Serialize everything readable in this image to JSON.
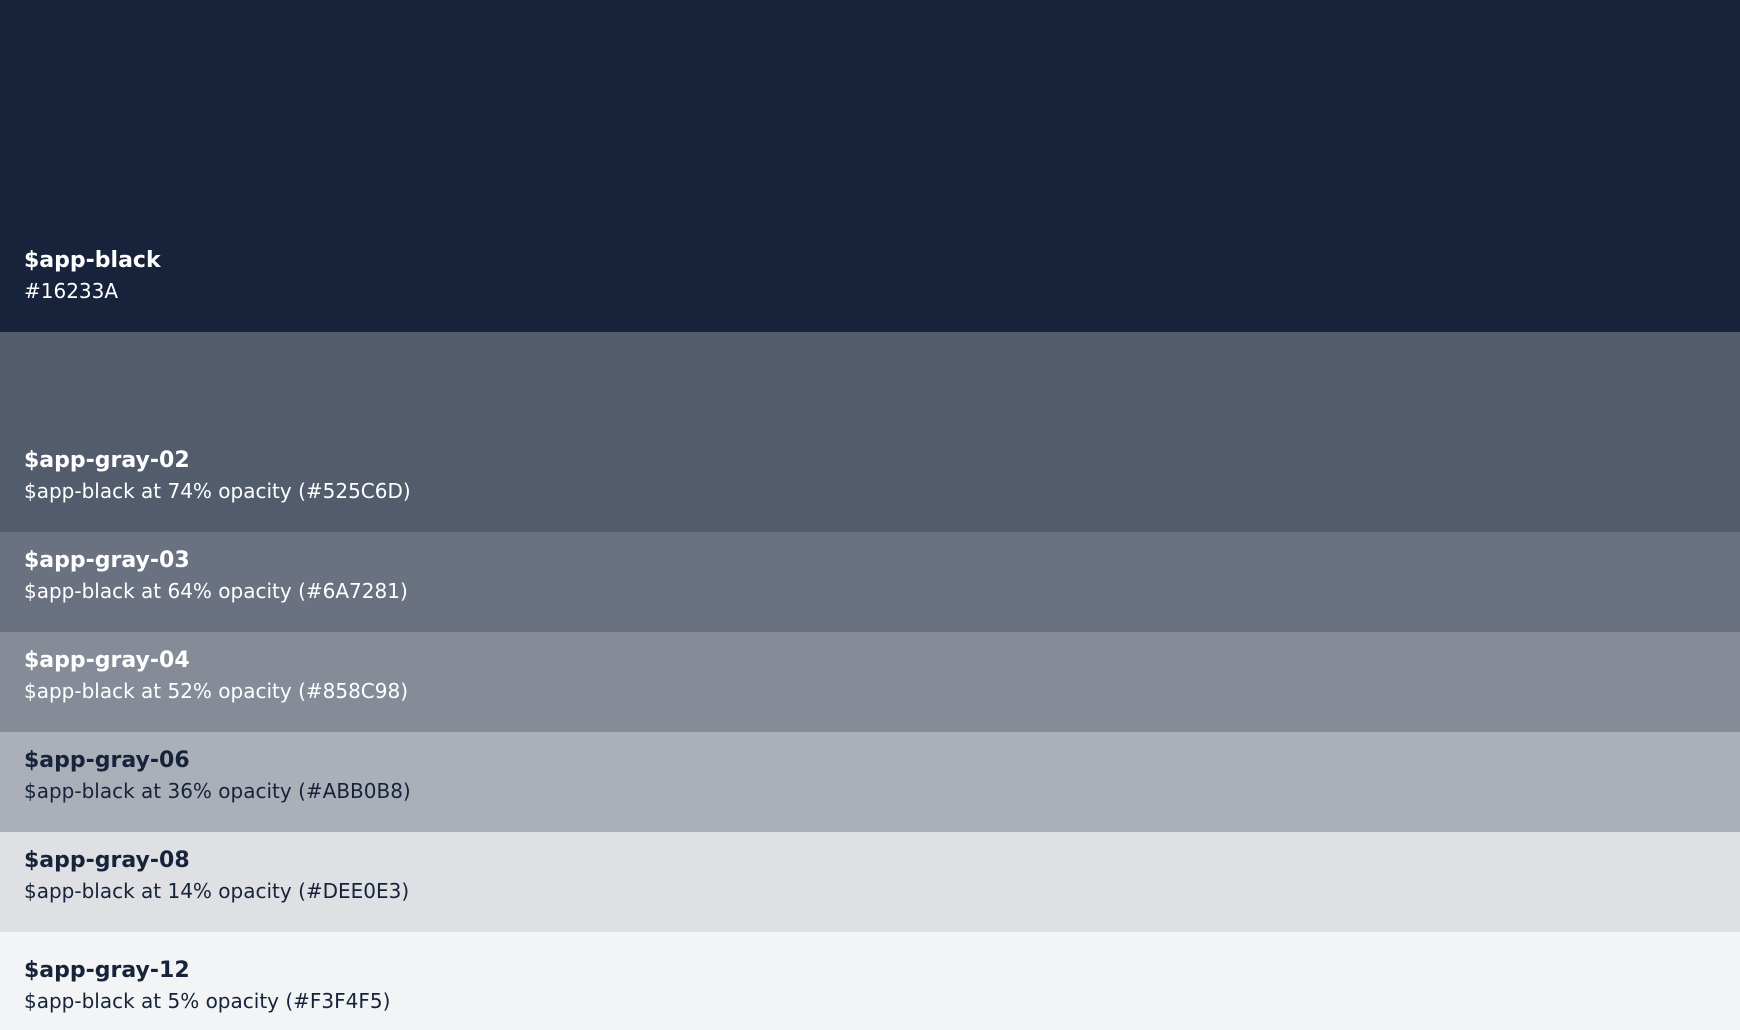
{
  "swatches": [
    {
      "name": "$app-black",
      "description": "#16233A",
      "color": "#16233A",
      "text": "light"
    },
    {
      "name": "$app-gray-02",
      "description": "$app-black at 74% opacity (#525C6D)",
      "color": "#525C6D",
      "text": "light"
    },
    {
      "name": "$app-gray-03",
      "description": "$app-black at 64% opacity (#6A7281)",
      "color": "#6A7281",
      "text": "light"
    },
    {
      "name": "$app-gray-04",
      "description": "$app-black at 52% opacity (#858C98)",
      "color": "#858C98",
      "text": "light"
    },
    {
      "name": "$app-gray-06",
      "description": "$app-black at 36% opacity (#ABB0B8)",
      "color": "#ABB0B8",
      "text": "dark"
    },
    {
      "name": "$app-gray-08",
      "description": "$app-black at 14% opacity (#DEE0E3)",
      "color": "#DEE0E3",
      "text": "dark"
    },
    {
      "name": "$app-gray-12",
      "description": "$app-black at 5% opacity (#F3F4F5)",
      "color": "#F3F4F5",
      "text": "dark"
    }
  ]
}
